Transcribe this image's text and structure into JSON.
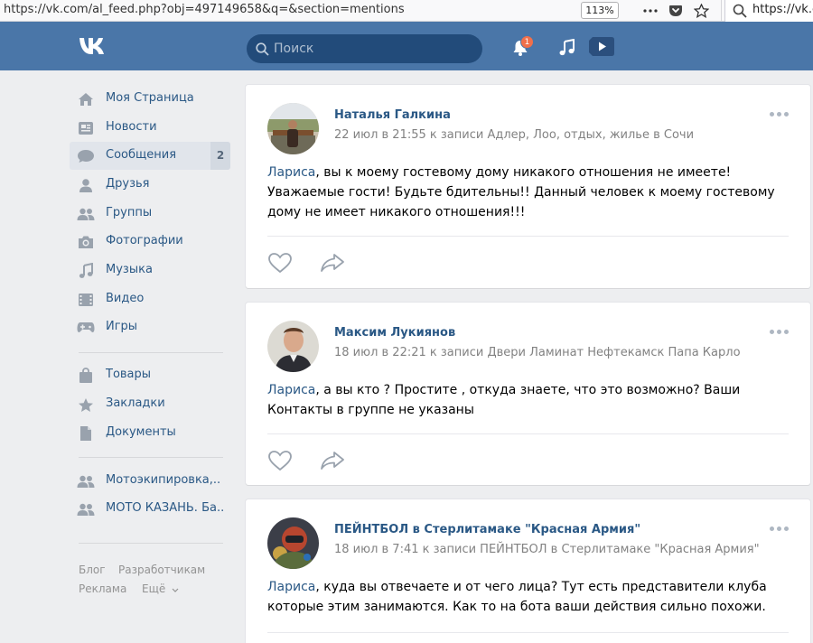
{
  "browser": {
    "url": "https://vk.com/al_feed.php?obj=497149658&q=&section=mentions",
    "zoom": "113%",
    "search_text": "https://vk.c"
  },
  "header": {
    "search_placeholder": "Поиск",
    "notification_count": "1"
  },
  "sidebar": {
    "items": [
      {
        "label": "Моя Страница",
        "icon": "home-icon"
      },
      {
        "label": "Новости",
        "icon": "news-icon"
      },
      {
        "label": "Сообщения",
        "icon": "messages-icon",
        "count": "2"
      },
      {
        "label": "Друзья",
        "icon": "friends-icon"
      },
      {
        "label": "Группы",
        "icon": "groups-icon"
      },
      {
        "label": "Фотографии",
        "icon": "camera-icon"
      },
      {
        "label": "Музыка",
        "icon": "music-icon"
      },
      {
        "label": "Видео",
        "icon": "video-icon"
      },
      {
        "label": "Игры",
        "icon": "games-icon"
      }
    ],
    "items2": [
      {
        "label": "Товары",
        "icon": "bag-icon"
      },
      {
        "label": "Закладки",
        "icon": "star-icon"
      },
      {
        "label": "Документы",
        "icon": "document-icon"
      }
    ],
    "groups": [
      {
        "label": "Мотоэкипировка,..",
        "icon": "group-icon"
      },
      {
        "label": "МОТО КАЗАНЬ. Ба..",
        "icon": "group-icon"
      }
    ],
    "footer": {
      "blog": "Блог",
      "developers": "Разработчикам",
      "ads": "Реклама",
      "more": "Ещё"
    }
  },
  "posts": [
    {
      "author": "Наталья Галкина",
      "meta": "22 июл в 21:55 к записи Адлер, Лоо, отдых, жилье в Сочи",
      "mention": "Лариса",
      "text": ", вы к моему гостевому дому никакого отношения не имеете! Уважаемые гости! Будьте бдительны!! Данный человек к моему гостевому дому не имеет никакого отношения!!!"
    },
    {
      "author": "Максим Лукиянов",
      "meta": "18 июл в 22:21 к записи Двери Ламинат Нефтекамск Папа Карло",
      "mention": "Лариса",
      "text": ", а вы кто ? Простите , откуда знаете, что это возможно? Ваши Контакты в группе не указаны"
    },
    {
      "author": "ПЕЙНТБОЛ в Стерлитамаке \"Красная Армия\"",
      "meta": "18 июл в 7:41 к записи ПЕЙНТБОЛ в Стерлитамаке \"Красная Армия\"",
      "mention": "Лариса",
      "text": ", куда вы отвечаете и от чего лица? Тут есть представители клуба которые этим занимаются. Как то на бота ваши действия сильно похожи."
    }
  ],
  "colors": {
    "header_bg": "#4a76a8",
    "link": "#2a5885",
    "page_bg": "#edeef0"
  }
}
